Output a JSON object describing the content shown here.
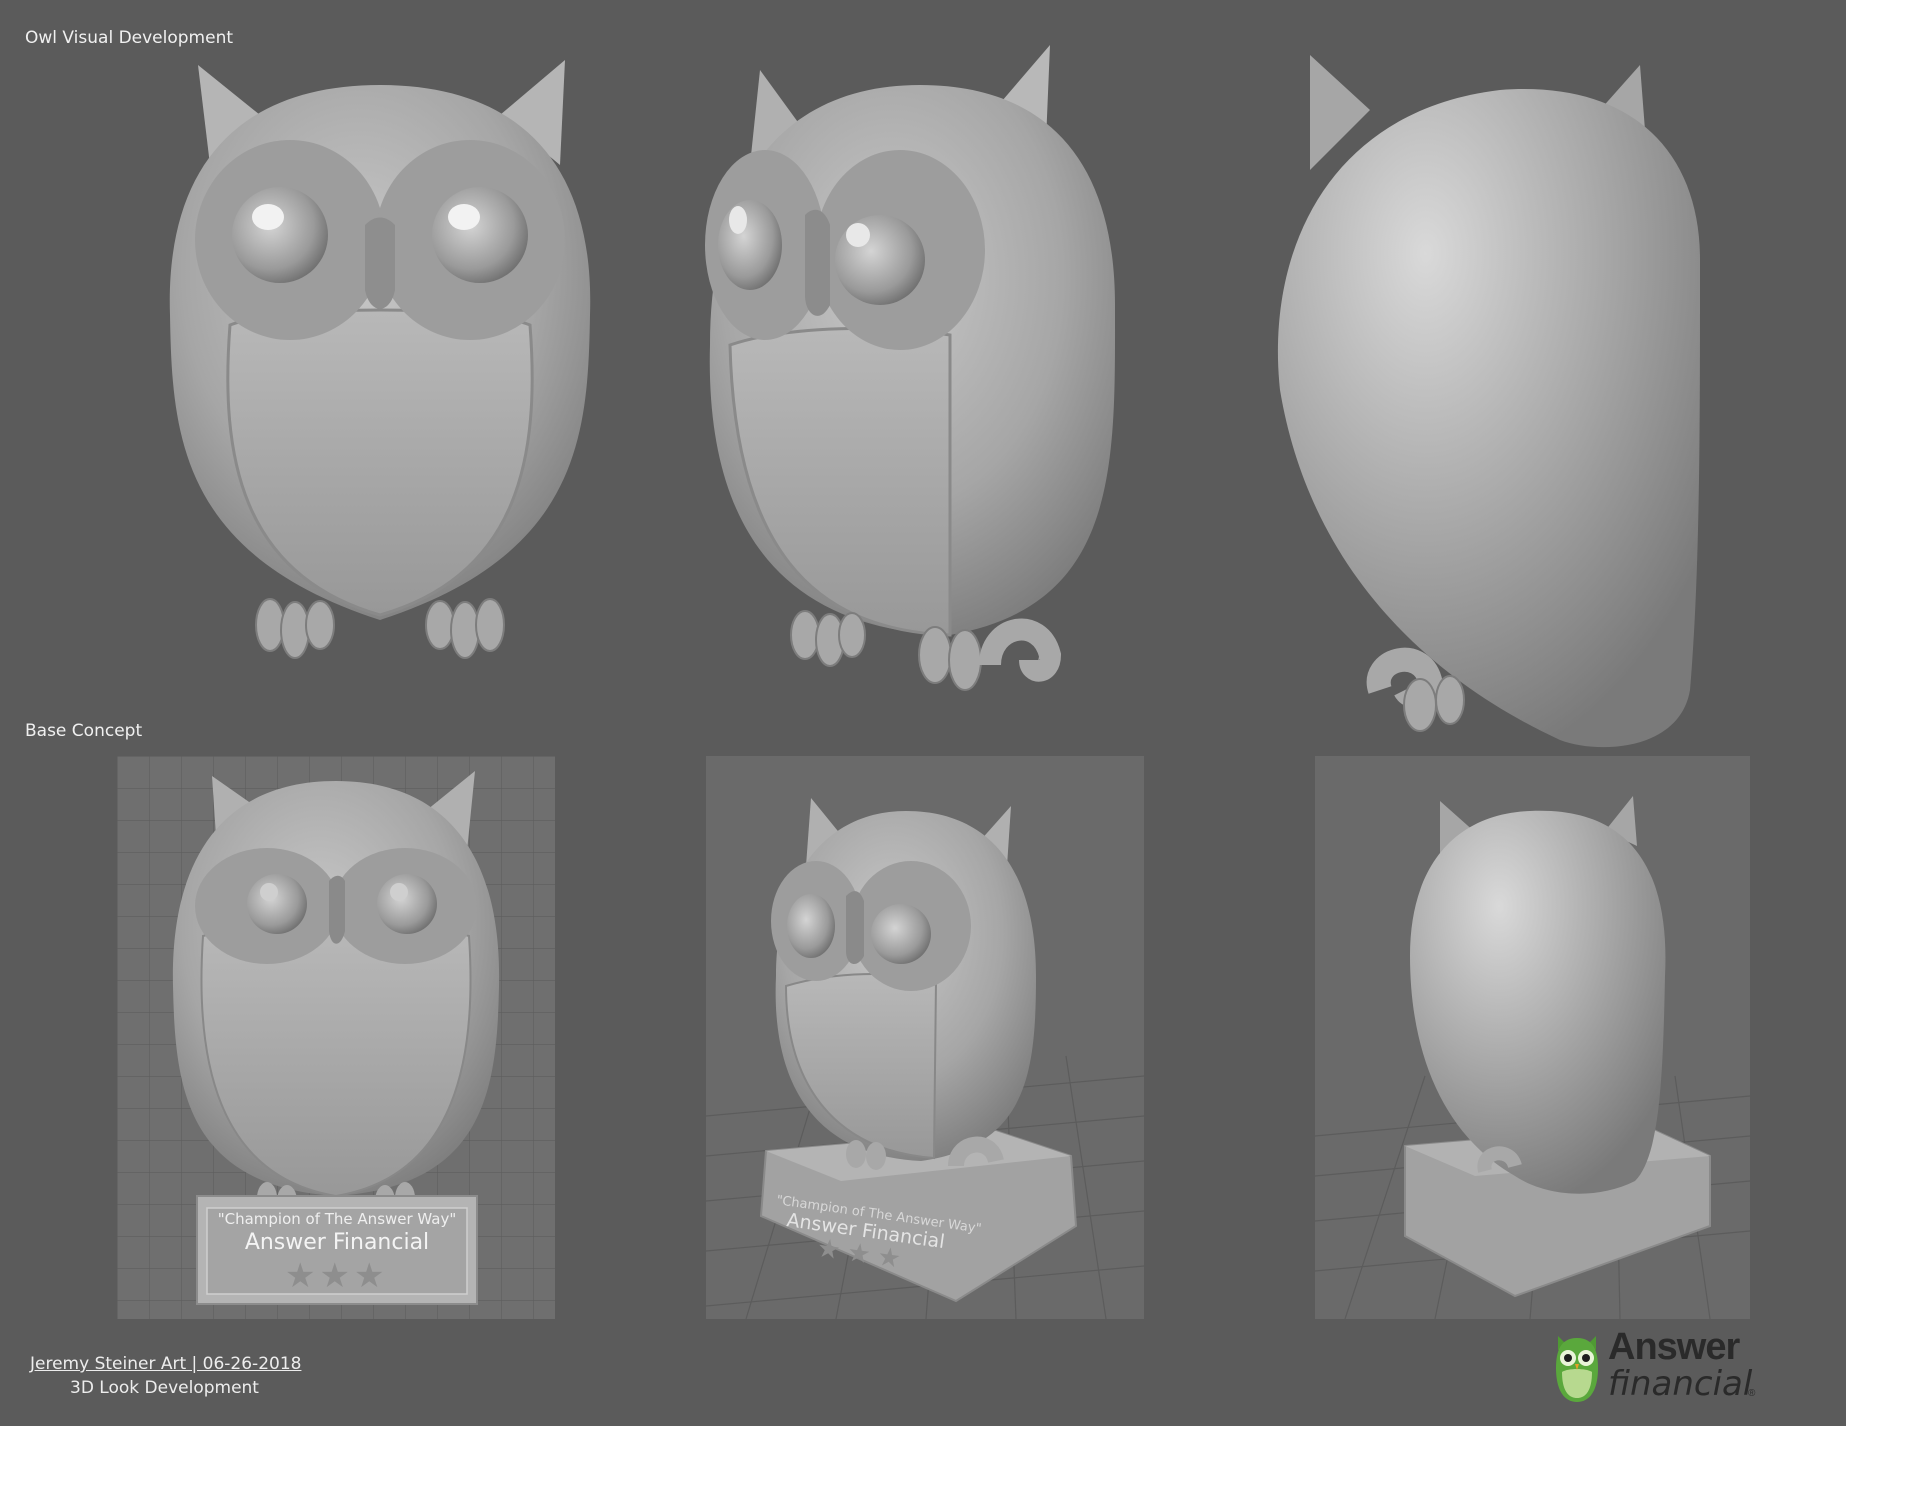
{
  "sections": {
    "top_title": "Owl Visual Development",
    "bottom_title": "Base Concept"
  },
  "plaque": {
    "line1": "\"Champion of The Answer Way\"",
    "line2": "Answer Financial"
  },
  "footer": {
    "credit": "Jeremy Steiner Art | 06-26-2018",
    "subtitle": "3D Look Development"
  },
  "logo": {
    "word1": "Answer",
    "word2": "financial",
    "mark": "®"
  },
  "colors": {
    "board": "#5b5b5b",
    "model": "#a9a9a9",
    "panel": "#6f6f6f",
    "logo_green": "#5aa83c"
  },
  "icons": [
    "owl-logo-icon",
    "star-icon"
  ]
}
